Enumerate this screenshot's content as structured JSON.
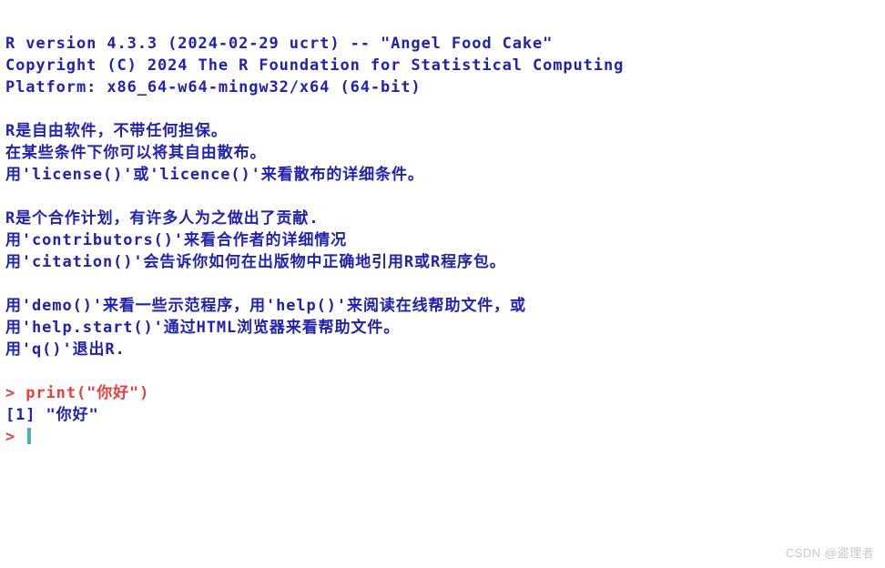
{
  "app": {
    "name": "R Console",
    "background_color": "#ffffff",
    "text_color": "#2222b0",
    "command_color": "#ee3b3b",
    "cursor_color": "#16c8d8"
  },
  "console": {
    "startup": {
      "version_line": "R version 4.3.3 (2024-02-29 ucrt) -- \"Angel Food Cake\"",
      "copyright_line": "Copyright (C) 2024 The R Foundation for Statistical Computing",
      "platform_line": "Platform: x86_64-w64-mingw32/x64 (64-bit)"
    },
    "license_block": [
      "R是自由软件，不带任何担保。",
      "在某些条件下你可以将其自由散布。",
      "用'license()'或'licence()'来看散布的详细条件。"
    ],
    "contributors_block": [
      "R是个合作计划，有许多人为之做出了贡献.",
      "用'contributors()'来看合作者的详细情况",
      "用'citation()'会告诉你如何在出版物中正确地引用R或R程序包。"
    ],
    "help_block": [
      "用'demo()'来看一些示范程序，用'help()'来阅读在线帮助文件，或",
      "用'help.start()'通过HTML浏览器来看帮助文件。",
      "用'q()'退出R."
    ],
    "session": {
      "prompt": "> ",
      "command": "print(\"你好\")",
      "output": "[1] \"你好\"",
      "current_prompt": "> "
    }
  },
  "watermark": {
    "text": "CSDN @盗理者"
  }
}
